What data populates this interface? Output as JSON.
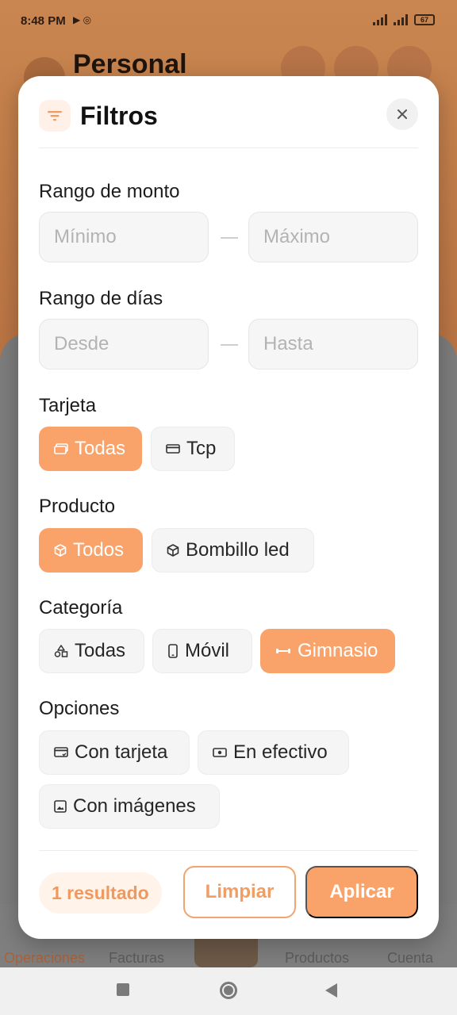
{
  "status_bar": {
    "time": "8:48 PM",
    "battery": "67"
  },
  "background": {
    "title": "Personal",
    "nav": [
      "Operaciones",
      "Facturas",
      "Productos",
      "Cuenta"
    ]
  },
  "modal": {
    "title": "Filtros",
    "amount_range": {
      "label": "Rango de monto",
      "min_placeholder": "Mínimo",
      "max_placeholder": "Máximo"
    },
    "days_range": {
      "label": "Rango de días",
      "from_placeholder": "Desde",
      "to_placeholder": "Hasta"
    },
    "card": {
      "label": "Tarjeta",
      "chips": [
        {
          "label": "Todas",
          "selected": true
        },
        {
          "label": "Tcp",
          "selected": false
        }
      ]
    },
    "product": {
      "label": "Producto",
      "chips": [
        {
          "label": "Todos",
          "selected": true
        },
        {
          "label": "Bombillo led",
          "selected": false
        }
      ]
    },
    "category": {
      "label": "Categoría",
      "chips": [
        {
          "label": "Todas",
          "selected": false
        },
        {
          "label": "Móvil",
          "selected": false
        },
        {
          "label": "Gimnasio",
          "selected": true
        }
      ]
    },
    "options": {
      "label": "Opciones",
      "chips": [
        {
          "label": "Con tarjeta",
          "selected": false
        },
        {
          "label": "En efectivo",
          "selected": false
        },
        {
          "label": "Con imágenes",
          "selected": false
        }
      ]
    },
    "footer": {
      "results": "1 resultado",
      "clear_label": "Limpiar",
      "apply_label": "Aplicar"
    }
  },
  "colors": {
    "accent": "#f9a36b",
    "accent_light": "#fff3ea",
    "chip_bg": "#f5f5f5"
  }
}
